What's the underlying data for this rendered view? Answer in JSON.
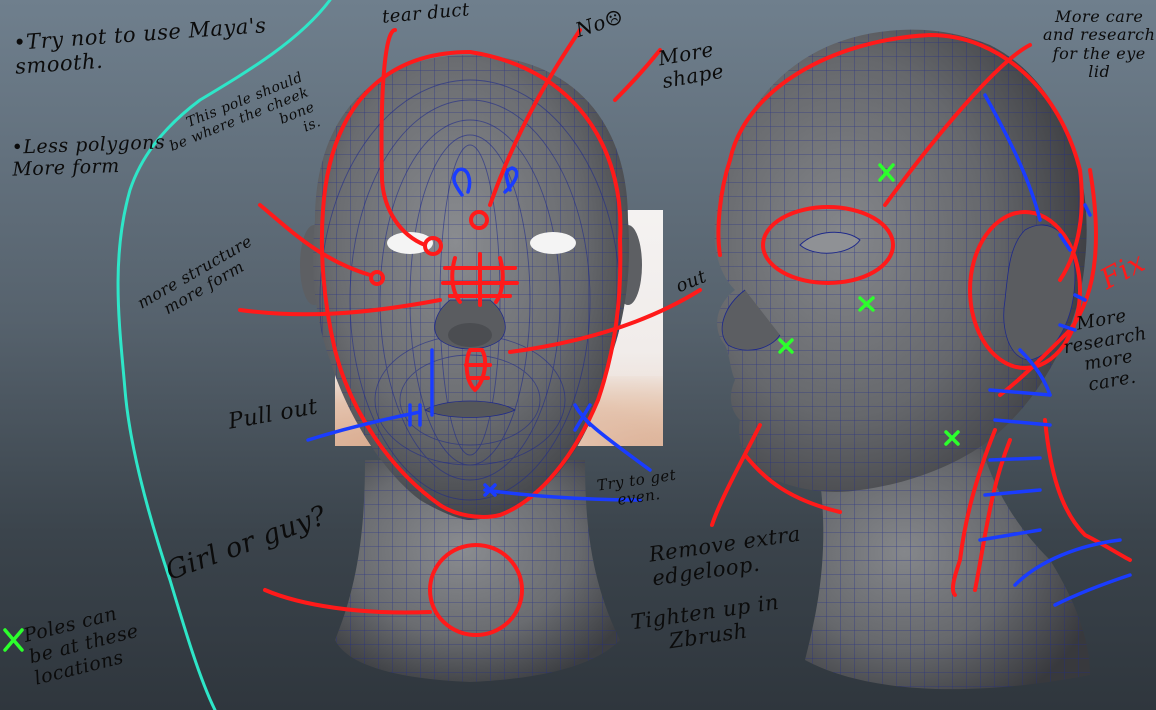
{
  "notes": {
    "maya_smooth": "•Try not to use Maya's\nsmooth.",
    "less_polygons": "•Less polygons\nMore form",
    "pole_cheek": "This pole should\nbe where the cheek\nbone\nis.",
    "tear_duct": "tear duct",
    "no": "No☹",
    "more_shape": "More\nshape",
    "more_structure": "more structure\nmore form",
    "out": "out",
    "pull_out": "Pull out",
    "try_even": "Try to get\neven.",
    "girl_or_guy": "Girl or guy?",
    "poles_locations": "Poles can\nbe at these\nlocations",
    "eye_lid": "More care\nand research\nfor the eye\nlid",
    "fix": "Fix",
    "more_research": "More\nresearch\nmore\ncare.",
    "remove_edgeloop": "Remove extra\nedgeloop.",
    "tighten": "Tighten up in\nZbrush"
  },
  "colors": {
    "annotation_red": "#ff1a1a",
    "annotation_blue": "#1a3cff",
    "annotation_green": "#2cff2c",
    "guide_cyan": "#2ee6c8",
    "mesh_gray": "#6c6e72",
    "wire_blue": "#1f2a8a"
  }
}
